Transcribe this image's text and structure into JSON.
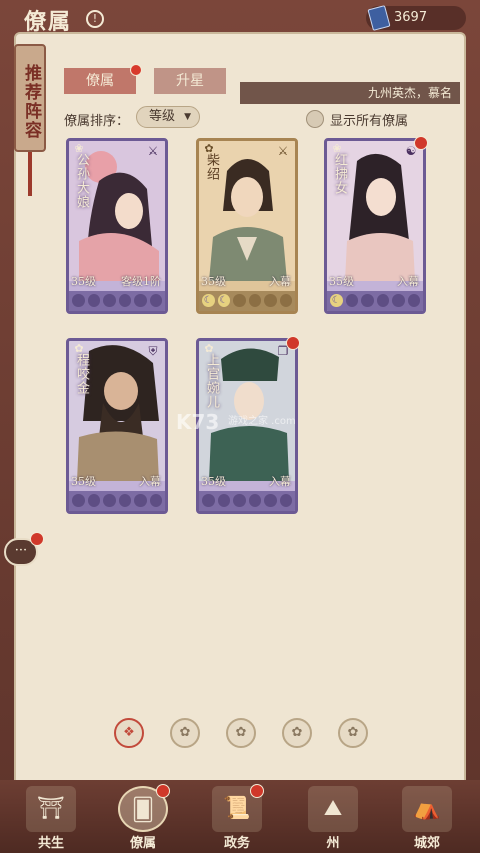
{
  "header": {
    "title": "僚属",
    "info_icon": "!",
    "currency": {
      "icon": "book-token-icon",
      "value": "3697"
    }
  },
  "side": {
    "recommend_label": "推荐阵容"
  },
  "tabs": [
    {
      "label": "僚属",
      "active": true
    },
    {
      "label": "升星",
      "active": false
    }
  ],
  "ticker": {
    "text": "九州英杰，慕名"
  },
  "filters": {
    "sort_label": "僚属排序：",
    "sort_value": "等级",
    "show_all_label": "显示所有僚属"
  },
  "cards": [
    {
      "name": "公孙大娘",
      "level": "35级",
      "status": "客级1阶",
      "rarity": "purple",
      "type_icon": "sword-icon",
      "moons": 0
    },
    {
      "name": "柴绍",
      "level": "35级",
      "status": "入幕",
      "rarity": "gold",
      "type_icon": "sword-icon",
      "moons": 2
    },
    {
      "name": "红拂女",
      "level": "35级",
      "status": "入幕",
      "rarity": "purple",
      "type_icon": "taiji-icon",
      "moons": 1
    },
    {
      "name": "程咬金",
      "level": "35级",
      "status": "入幕",
      "rarity": "purple",
      "type_icon": "shield-icon",
      "moons": 0
    },
    {
      "name": "上官婉儿",
      "level": "35级",
      "status": "入幕",
      "rarity": "purple",
      "type_icon": "book-icon",
      "moons": 0
    }
  ],
  "watermark": {
    "main": "K73",
    "sub": "游戏之家 .com"
  },
  "chat": {
    "icon": "chat-bubble-icon"
  },
  "bottom_nav": [
    {
      "label": "共生",
      "icon": "pavilion-icon",
      "active": false,
      "badge": false
    },
    {
      "label": "僚属",
      "icon": "cards-icon",
      "active": true,
      "badge": true
    },
    {
      "label": "政务",
      "icon": "scroll-icon",
      "active": false,
      "badge": true
    },
    {
      "label": "州",
      "icon": "mountain-icon",
      "active": false,
      "badge": false
    },
    {
      "label": "城郊",
      "icon": "countryside-icon",
      "active": false,
      "badge": false
    }
  ],
  "colors": {
    "frame": "#6e3f34",
    "paper": "#efe5d2",
    "purple_rarity": "#6c5a94",
    "gold_rarity": "#a78452",
    "badge_red": "#d0382a"
  }
}
